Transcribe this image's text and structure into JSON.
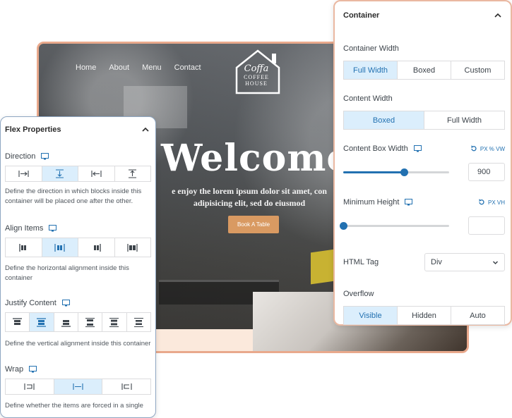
{
  "site": {
    "nav": [
      "Home",
      "About",
      "Menu",
      "Contact"
    ],
    "logo": {
      "name": "Coffa",
      "sub1": "COFFEE",
      "sub2": "HOUSE"
    },
    "heading": "Welcome",
    "tagline_line1": "e enjoy the lorem ipsum dolor sit amet, con",
    "tagline_line2": "adipisicing elit, sed do eiusmod",
    "cta": "Book A Table"
  },
  "flex_panel": {
    "title": "Flex Properties",
    "direction": {
      "label": "Direction",
      "active_index": 1,
      "help": "Define the direction in which blocks inside this container will be placed one after the other."
    },
    "align_items": {
      "label": "Align Items",
      "active_index": 1,
      "help": "Define the horizontal alignment inside this container"
    },
    "justify_content": {
      "label": "Justify Content",
      "active_index": 1,
      "help": "Define the vertical alignment inside this container"
    },
    "wrap": {
      "label": "Wrap",
      "active_index": 1,
      "help": "Define whether the items are forced in a single"
    }
  },
  "container_panel": {
    "title": "Container",
    "container_width": {
      "label": "Container Width",
      "options": [
        "Full Width",
        "Boxed",
        "Custom"
      ],
      "active_index": 0
    },
    "content_width": {
      "label": "Content Width",
      "options": [
        "Boxed",
        "Full Width"
      ],
      "active_index": 0
    },
    "content_box_width": {
      "label": "Content Box Width",
      "units": "PX % VW",
      "value": "900",
      "slider_fraction": 0.57
    },
    "minimum_height": {
      "label": "Minimum Height",
      "units": "PX VH",
      "value": "",
      "slider_fraction": 0.0
    },
    "html_tag": {
      "label": "HTML Tag",
      "value": "Div"
    },
    "overflow": {
      "label": "Overflow",
      "options": [
        "Visible",
        "Hidden",
        "Auto"
      ],
      "active_index": 0
    }
  },
  "colors": {
    "accent": "#2271b1",
    "active_bg": "#dbeefc",
    "preview_border": "#e9a98c",
    "cta": "#d99a62"
  }
}
